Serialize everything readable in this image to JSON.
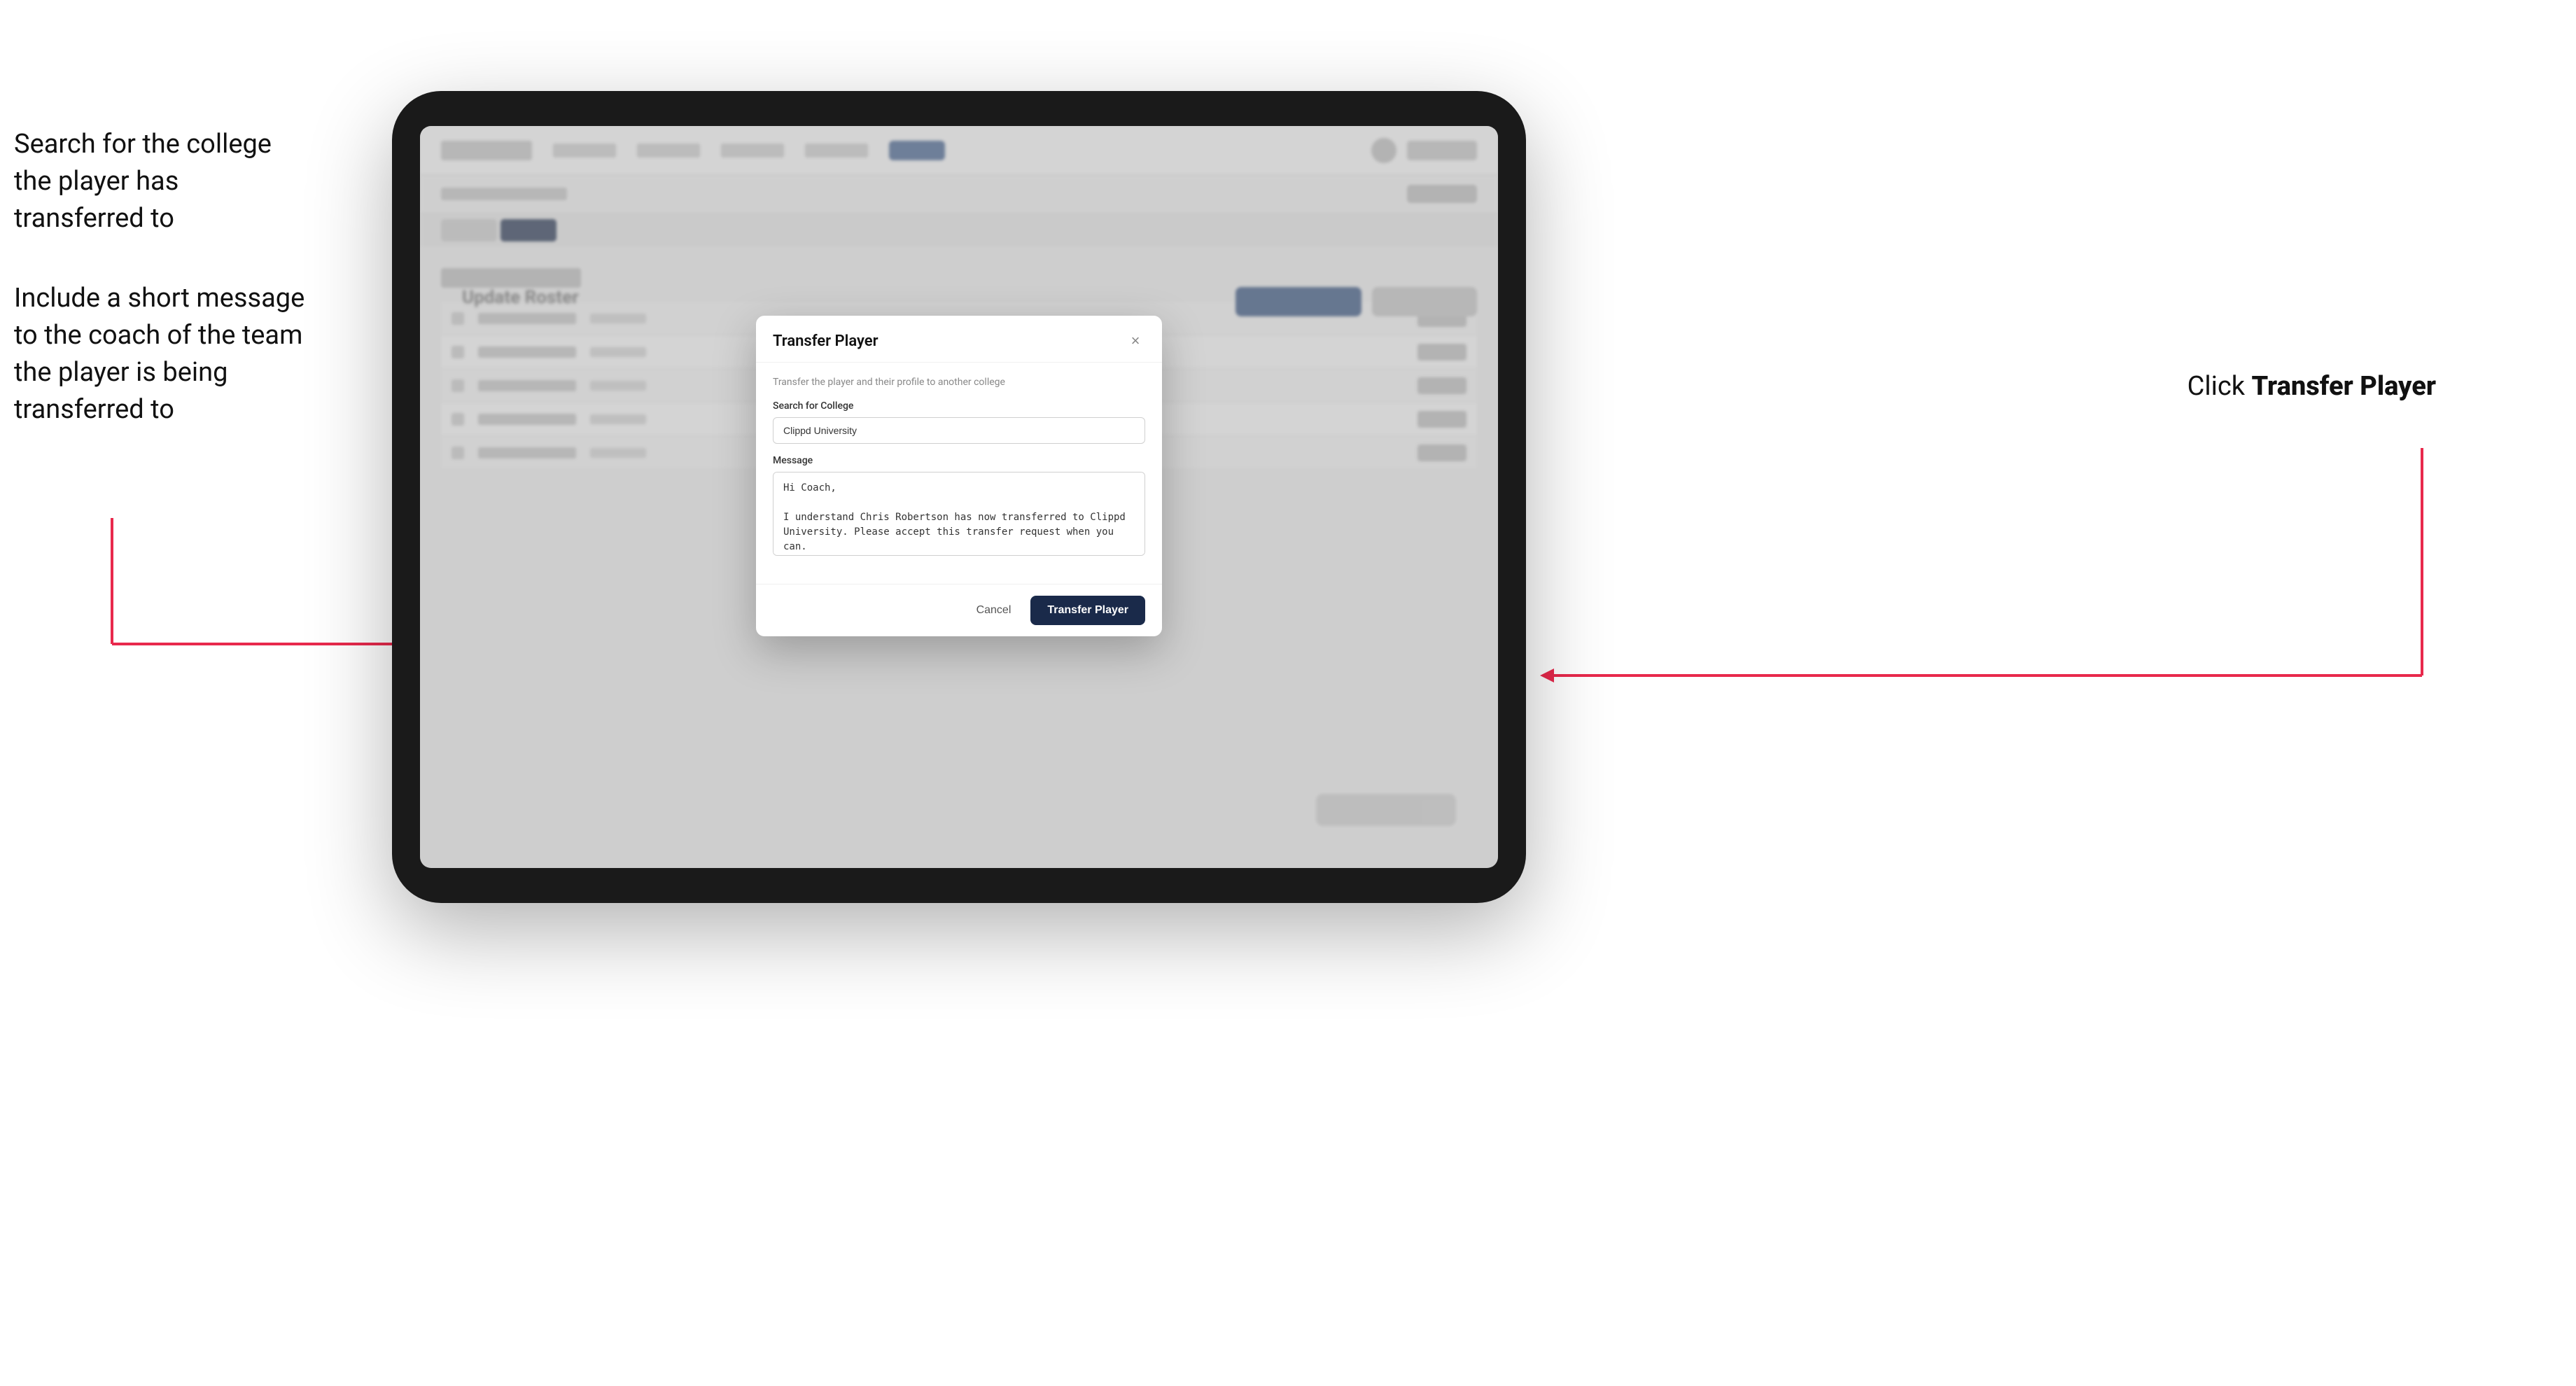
{
  "annotations": {
    "left_text_1": "Search for the college the player has transferred to",
    "left_text_2": "Include a short message to the coach of the team the player is being transferred to",
    "right_text_prefix": "Click ",
    "right_text_bold": "Transfer Player"
  },
  "tablet": {
    "bg": {
      "logo_alt": "Logo",
      "page_title": "Update Roster"
    }
  },
  "modal": {
    "title": "Transfer Player",
    "close_label": "×",
    "description": "Transfer the player and their profile to another college",
    "college_label": "Search for College",
    "college_value": "Clippd University",
    "message_label": "Message",
    "message_value": "Hi Coach,\n\nI understand Chris Robertson has now transferred to Clippd University. Please accept this transfer request when you can.",
    "cancel_label": "Cancel",
    "transfer_label": "Transfer Player"
  }
}
